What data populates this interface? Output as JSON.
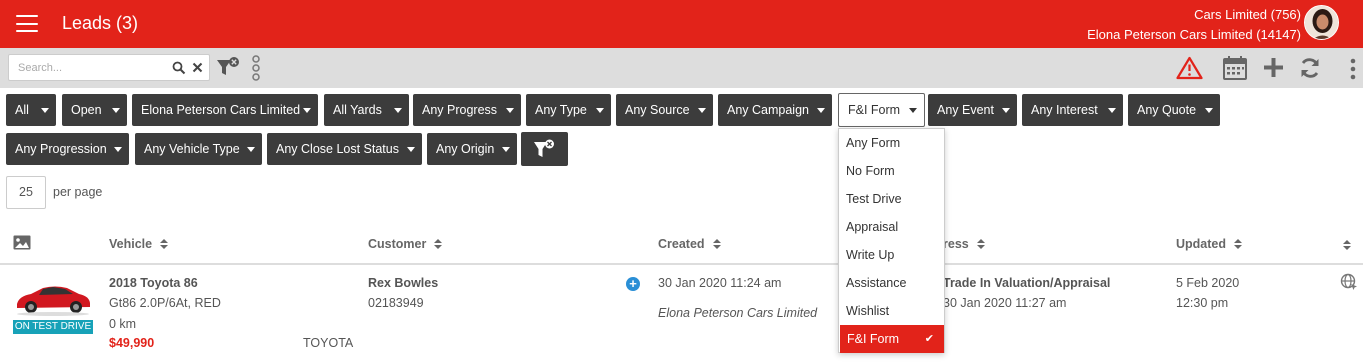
{
  "header": {
    "title": "Leads (3)",
    "account_line1": "Cars Limited (756)",
    "account_line2": "Elona Peterson Cars Limited (14147)"
  },
  "toolbar": {
    "search_placeholder": "Search..."
  },
  "filters": {
    "row1": [
      "All",
      "Open",
      "Elona Peterson Cars Limited",
      "All Yards",
      "Any Progress",
      "Any Type",
      "Any Source",
      "Any Campaign",
      "F&I Form",
      "Any Event",
      "Any Interest",
      "Any Quote"
    ],
    "row2": [
      "Any Progression",
      "Any Vehicle Type",
      "Any Close Lost Status",
      "Any Origin"
    ]
  },
  "dropdown": {
    "options": [
      "Any Form",
      "No Form",
      "Test Drive",
      "Appraisal",
      "Write Up",
      "Assistance",
      "Wishlist",
      "F&I Form"
    ],
    "selected": "F&I Form",
    "check": "✔"
  },
  "paging": {
    "per_page_value": "25",
    "per_page_label": "per page"
  },
  "table": {
    "columns": {
      "vehicle": "Vehicle",
      "customer": "Customer",
      "created": "Created",
      "progress": "ress",
      "updated": "Updated"
    },
    "rows": [
      {
        "vehicle_title": "2018 Toyota 86",
        "vehicle_desc": "Gt86 2.0P/6At, RED",
        "vehicle_km": "0 km",
        "vehicle_price": "$49,990",
        "vehicle_make": "TOYOTA",
        "badge": "ON TEST DRIVE",
        "customer_name": "Rex Bowles",
        "customer_phone": "02183949",
        "created_date": "30 Jan 2020 11:24 am",
        "created_by": "Elona Peterson Cars Limited",
        "progress_title": "Trade In Valuation/Appraisal",
        "progress_date": "30 Jan 2020 11:27 am",
        "updated_date": "5 Feb 2020",
        "updated_time": "12:30 pm"
      }
    ]
  },
  "colors": {
    "brand_red": "#e2231a",
    "filter_dark": "#3c3c3c",
    "badge_teal": "#17a2b8",
    "plus_blue": "#2a8fd6"
  }
}
